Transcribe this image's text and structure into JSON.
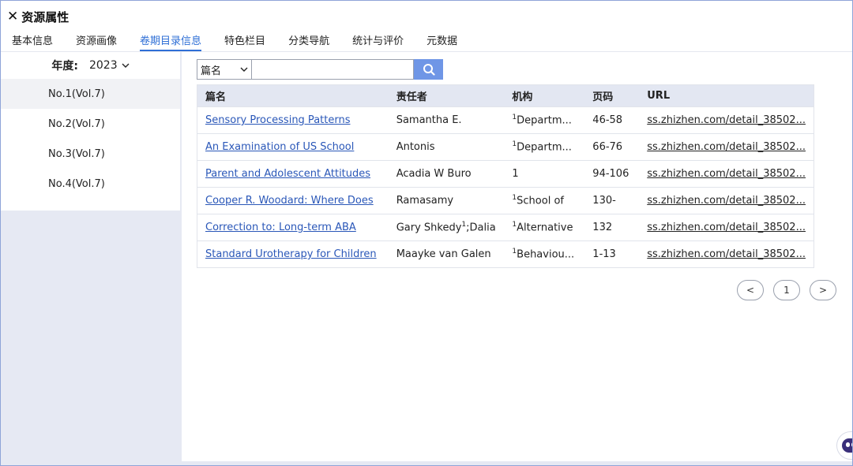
{
  "header": {
    "close_glyph": "✕",
    "title": "资源属性"
  },
  "tabs": [
    {
      "label": "基本信息",
      "active": false
    },
    {
      "label": "资源画像",
      "active": false
    },
    {
      "label": "卷期目录信息",
      "active": true
    },
    {
      "label": "特色栏目",
      "active": false
    },
    {
      "label": "分类导航",
      "active": false
    },
    {
      "label": "统计与评价",
      "active": false
    },
    {
      "label": "元数据",
      "active": false
    }
  ],
  "sidebar": {
    "year_label": "年度:",
    "year_value": "2023",
    "issues": [
      "No.1(Vol.7)",
      "No.2(Vol.7)",
      "No.3(Vol.7)",
      "No.4(Vol.7)"
    ],
    "selected_issue": 0
  },
  "search": {
    "field_select": "篇名",
    "input_value": "",
    "input_placeholder": ""
  },
  "table": {
    "columns": [
      "篇名",
      "责任者",
      "机构",
      "页码",
      "URL"
    ],
    "rows": [
      {
        "title": "Sensory Processing Patterns",
        "author": "Samantha E.",
        "org_sup": "1",
        "org": "Departm...",
        "pages": "46-58",
        "url": "ss.zhizhen.com/detail_38502..."
      },
      {
        "title": "An Examination of US School",
        "author": "Antonis",
        "org_sup": "1",
        "org": "Departm...",
        "pages": "66-76",
        "url": "ss.zhizhen.com/detail_38502..."
      },
      {
        "title": "Parent and Adolescent Attitudes",
        "author": "Acadia W Buro",
        "org_sup": "",
        "org": "1",
        "pages": "94-106",
        "url": "ss.zhizhen.com/detail_38502..."
      },
      {
        "title": "Cooper R. Woodard: Where Does",
        "author": "Ramasamy",
        "org_sup": "1",
        "org": "School of",
        "pages": "130-",
        "url": "ss.zhizhen.com/detail_38502..."
      },
      {
        "title": "Correction to: Long-term ABA",
        "author": "Gary Shkedy",
        "author_sup": "1",
        "author_tail": ";Dalia",
        "org_sup": "1",
        "org": "Alternative",
        "pages": "132",
        "url": "ss.zhizhen.com/detail_38502..."
      },
      {
        "title": "Standard Urotherapy for Children",
        "author": "Maayke van Galen",
        "org_sup": "1",
        "org": "Behaviou...",
        "pages": "1-13",
        "url": "ss.zhizhen.com/detail_38502..."
      }
    ]
  },
  "pager": {
    "prev": "<",
    "page": "1",
    "next": ">"
  },
  "colors": {
    "accent": "#2f6fd6",
    "search_button": "#6f96e6",
    "header_row": "#e3e7f2",
    "side_bg": "#e6e9f3"
  }
}
